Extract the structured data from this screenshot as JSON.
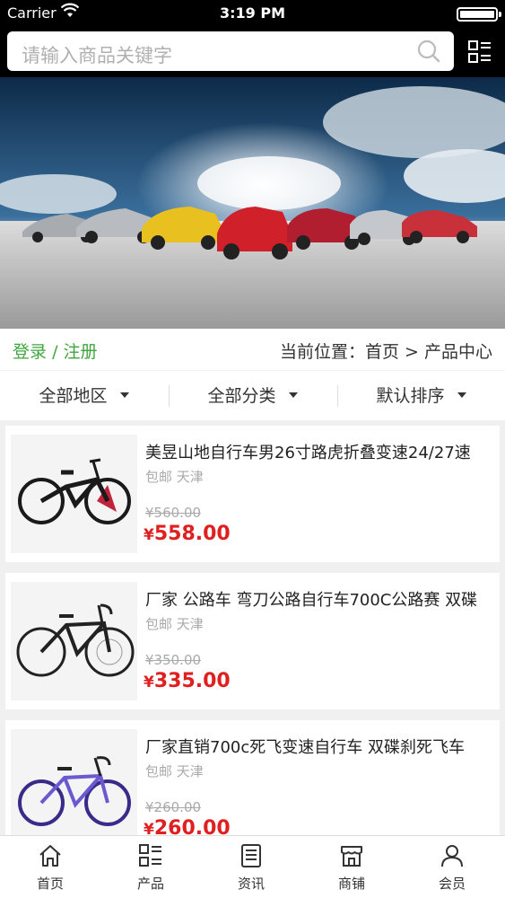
{
  "status_bar": {
    "carrier": "Carrier",
    "time": "3:19 PM"
  },
  "search": {
    "placeholder": "请输入商品关键字"
  },
  "breadcrumb": {
    "login": "登录",
    "separator": "/",
    "register": "注册",
    "position": "当前位置：首页 > 产品中心"
  },
  "filters": [
    {
      "label": "全部地区"
    },
    {
      "label": "全部分类"
    },
    {
      "label": "默认排序"
    }
  ],
  "products": [
    {
      "title": "美昱山地自行车男26寸路虎折叠变速24/27速",
      "location": "包邮 天津",
      "old_price": "¥560.00",
      "price_symbol": "¥",
      "price": "558.00",
      "frame_color": "#1a1a1a",
      "accent_color": "#c0243a"
    },
    {
      "title": "厂家 公路车 弯刀公路自行车700C公路赛 双碟",
      "location": "包邮 天津",
      "old_price": "¥350.00",
      "price_symbol": "¥",
      "price": "335.00",
      "frame_color": "#222222",
      "accent_color": "#555555"
    },
    {
      "title": "厂家直销700c死飞变速自行车 双碟刹死飞车",
      "location": "包邮 天津",
      "old_price": "¥260.00",
      "price_symbol": "¥",
      "price": "260.00",
      "frame_color": "#3a2a8a",
      "accent_color": "#6a5ad0"
    }
  ],
  "tabs": [
    {
      "label": "首页",
      "icon": "home-icon"
    },
    {
      "label": "产品",
      "icon": "product-list-icon"
    },
    {
      "label": "资讯",
      "icon": "news-icon"
    },
    {
      "label": "商铺",
      "icon": "shop-icon"
    },
    {
      "label": "会员",
      "icon": "member-icon"
    }
  ],
  "colors": {
    "price": "#e02020",
    "login_link": "#3fa53f",
    "header_bg": "#000000"
  }
}
